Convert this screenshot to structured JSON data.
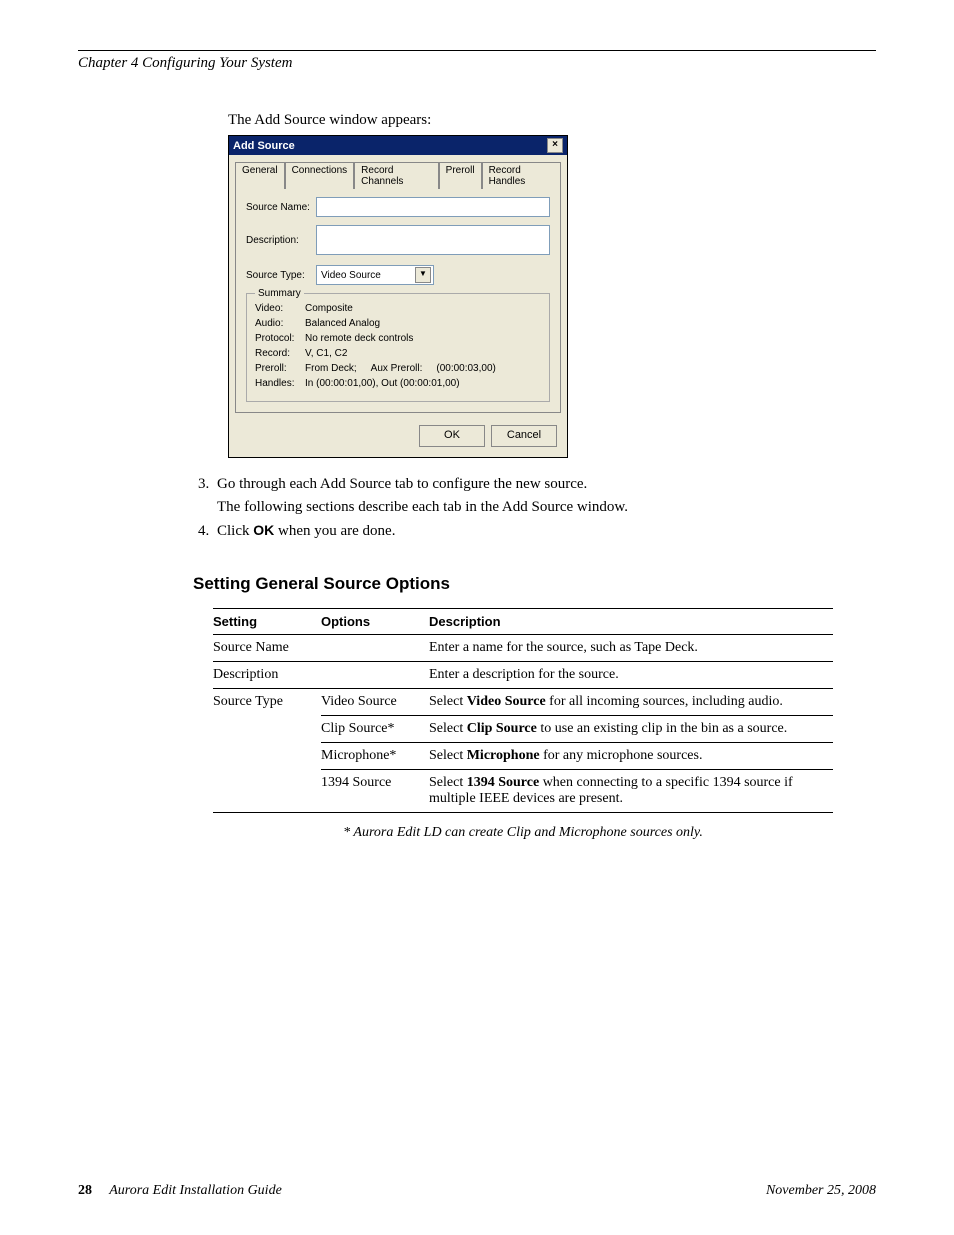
{
  "header": {
    "chapter_line": "Chapter 4   Configuring Your System"
  },
  "intro": "The Add Source window appears:",
  "dialog": {
    "title": "Add Source",
    "tabs": [
      "General",
      "Connections",
      "Record Channels",
      "Preroll",
      "Record Handles"
    ],
    "source_name_label": "Source Name:",
    "description_label": "Description:",
    "source_type_label": "Source Type:",
    "source_type_value": "Video Source",
    "summary_legend": "Summary",
    "summary": {
      "video_label": "Video:",
      "video_value": "Composite",
      "audio_label": "Audio:",
      "audio_value": "Balanced Analog",
      "protocol_label": "Protocol:",
      "protocol_value": "No remote deck controls",
      "record_label": "Record:",
      "record_value": "V, C1, C2",
      "preroll_label": "Preroll:",
      "preroll_value_1": "From Deck;",
      "preroll_value_2": "Aux Preroll:",
      "preroll_value_3": "(00:00:03,00)",
      "handles_label": "Handles:",
      "handles_value": "In  (00:00:01,00), Out (00:00:01,00)"
    },
    "ok_label": "OK",
    "cancel_label": "Cancel"
  },
  "steps": {
    "s3": "Go through each Add Source tab to configure the new source.",
    "s3_sub": "The following sections describe each tab in the Add Source window.",
    "s4_pre": "Click ",
    "s4_bold": "OK",
    "s4_post": " when you are done."
  },
  "section_heading": "Setting General Source Options",
  "table": {
    "headers": {
      "setting": "Setting",
      "options": "Options",
      "description": "Description"
    },
    "rows": [
      {
        "setting": "Source Name",
        "option": "",
        "desc_pre": "Enter a name for the source, such as Tape Deck.",
        "bold": "",
        "desc_post": ""
      },
      {
        "setting": "Description",
        "option": "",
        "desc_pre": "Enter a description for the source.",
        "bold": "",
        "desc_post": ""
      },
      {
        "setting": "Source Type",
        "option": "Video Source",
        "desc_pre": "Select ",
        "bold": "Video Source",
        "desc_post": " for all incoming sources, including audio."
      },
      {
        "setting": "",
        "option": "Clip Source*",
        "desc_pre": "Select ",
        "bold": "Clip Source",
        "desc_post": " to use an existing clip in the bin as a source."
      },
      {
        "setting": "",
        "option": "Microphone*",
        "desc_pre": "Select ",
        "bold": "Microphone",
        "desc_post": " for any microphone sources."
      },
      {
        "setting": "",
        "option": "1394 Source",
        "desc_pre": "Select ",
        "bold": "1394 Source",
        "desc_post": " when connecting to a specific 1394 source if multiple IEEE devices are present."
      }
    ]
  },
  "footnote": "* Aurora Edit LD can create Clip and Microphone sources only.",
  "footer": {
    "page_no": "28",
    "doc_title": "Aurora Edit Installation Guide",
    "date": "November 25, 2008"
  }
}
